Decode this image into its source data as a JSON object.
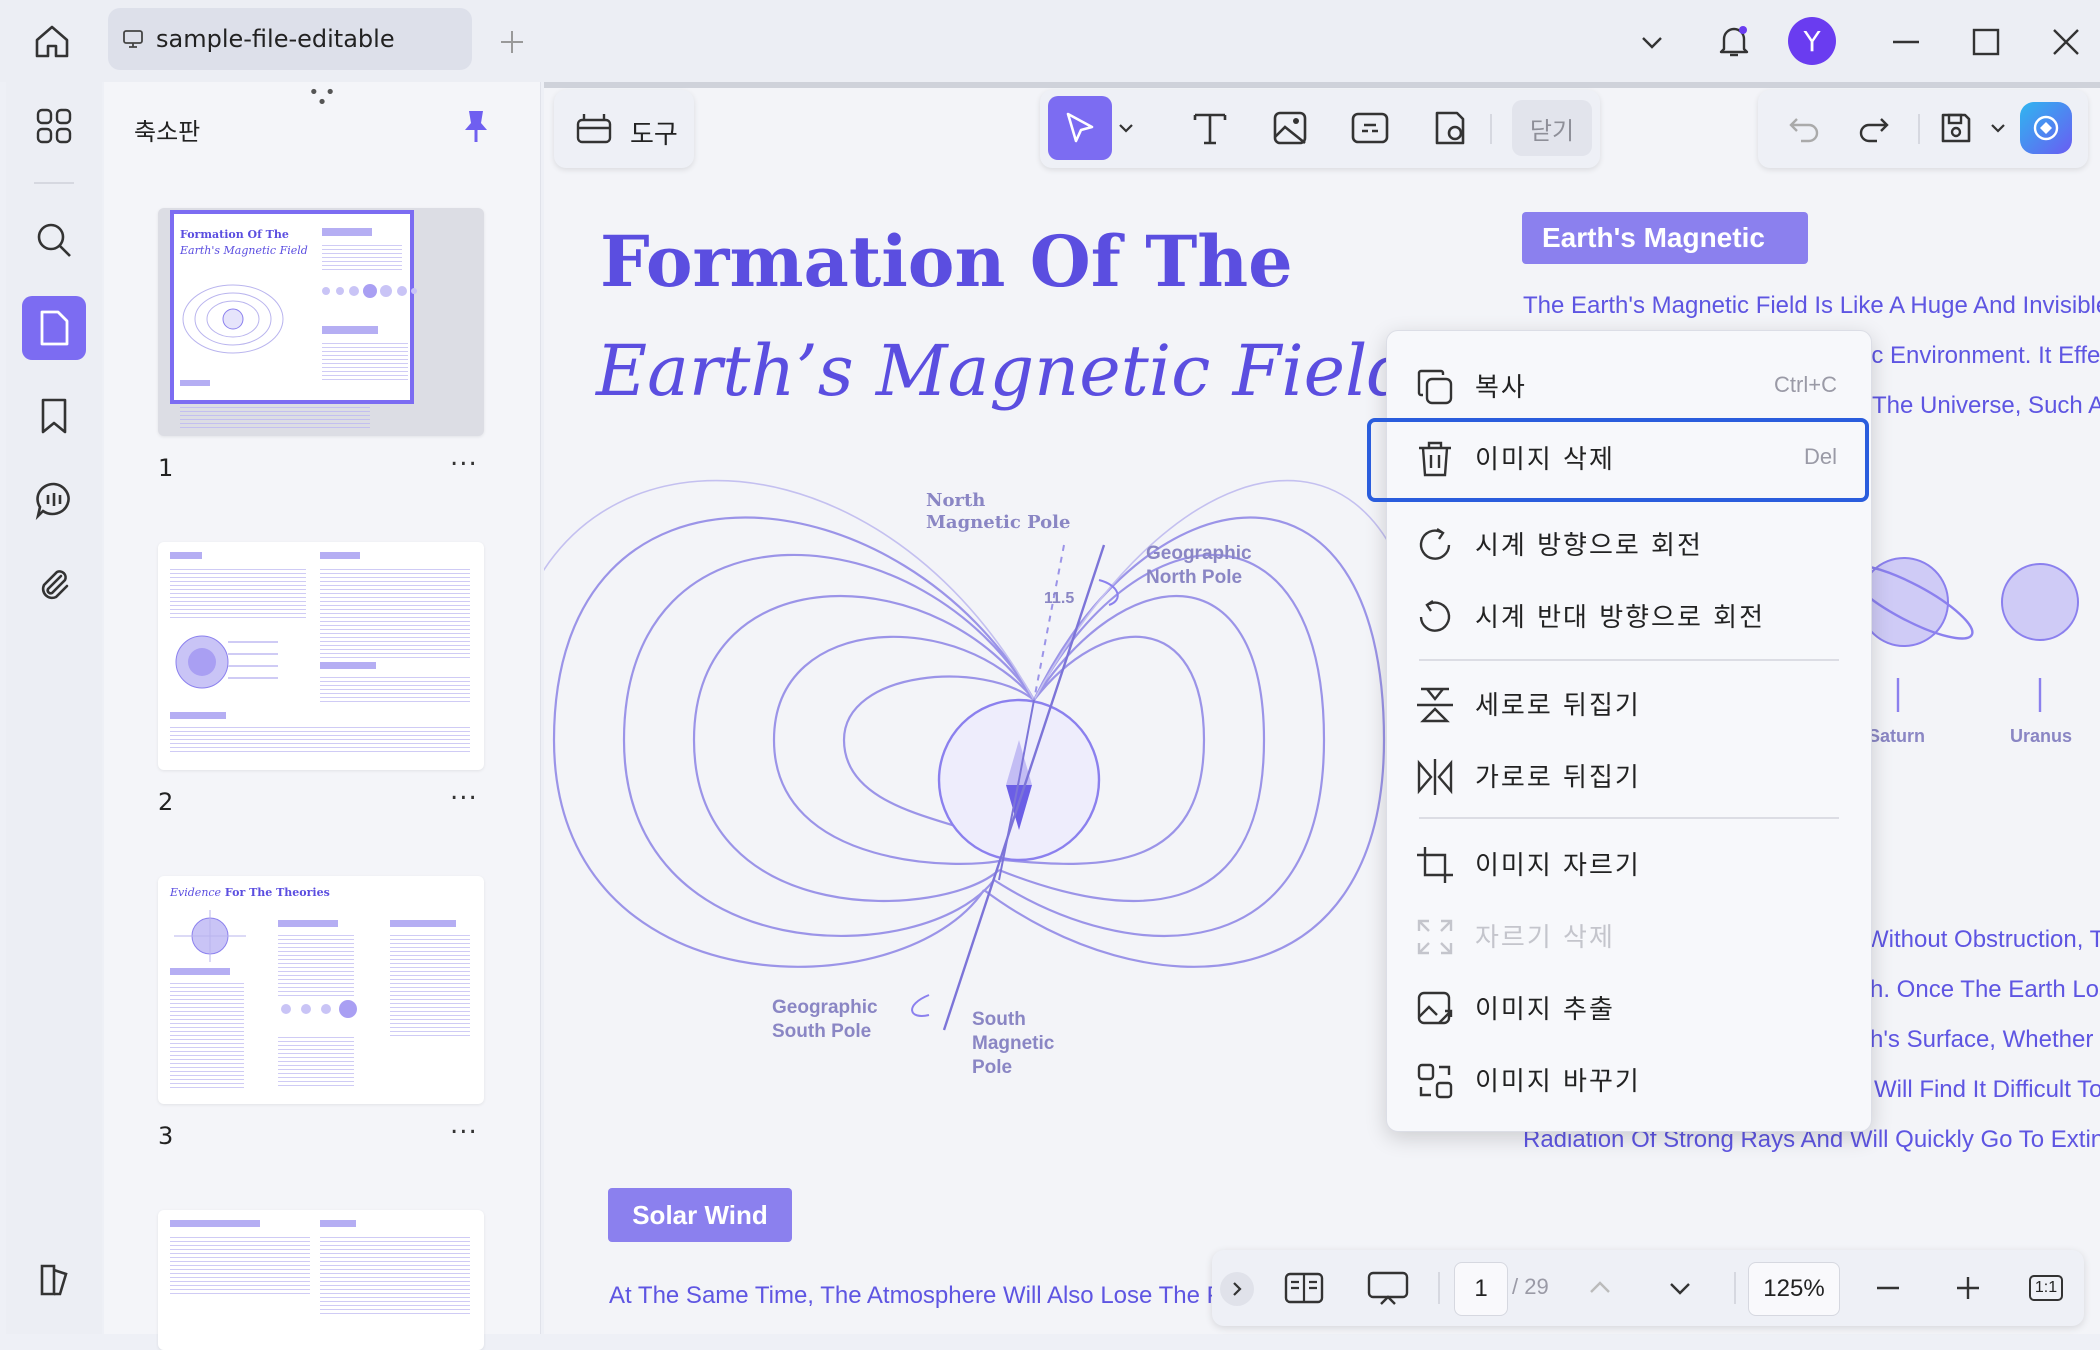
{
  "titlebar": {
    "tab_title": "sample-file-editable",
    "avatar_letter": "Y"
  },
  "panel": {
    "title": "축소판",
    "pages": [
      {
        "number": "1",
        "more": "..."
      },
      {
        "number": "2",
        "more": "..."
      },
      {
        "number": "3",
        "more": "..."
      }
    ]
  },
  "toolbar": {
    "tools_label": "도구",
    "close_label": "닫기"
  },
  "document": {
    "title_line1": "Formation Of The",
    "title_line2": "Earth’s Magnetic Field",
    "section_earth": "Earth's Magnetic",
    "earth_lines": [
      "The Earth's Magnetic Field Is Like A Huge And Invisible",
      "ic Environment. It Effe",
      "The Universe, Such A"
    ],
    "diagram_labels": {
      "north_magnetic_pole": "North\nMagnetic Pole",
      "geographic_north_pole": "Geographic\nNorth Pole",
      "angle": "11.5",
      "geographic_south_pole": "Geographic\nSouth Pole",
      "south_magnetic_pole": "South\nMagnetic\nPole"
    },
    "planets": [
      "Saturn",
      "Uranus"
    ],
    "right_lines": [
      "Without Obstruction, Th",
      "h. Once The Earth Los",
      "h's Surface, Whether",
      "Will Find It Difficult To",
      "Radiation Of Strong Rays And Will Quickly Go To Extin"
    ],
    "section_solar": "Solar Wind",
    "bottom_line": "At The Same Time, The Atmosphere Will Also Lose The P"
  },
  "context_menu": {
    "items": [
      {
        "label": "복사",
        "shortcut": "Ctrl+C"
      },
      {
        "label": "이미지 삭제",
        "shortcut": "Del"
      },
      {
        "label": "시계 방향으로 회전"
      },
      {
        "label": "시계 반대 방향으로 회전"
      },
      {
        "label": "세로로 뒤집기"
      },
      {
        "label": "가로로 뒤집기"
      },
      {
        "label": "이미지 자르기"
      },
      {
        "label": "자르기 삭제"
      },
      {
        "label": "이미지 추출"
      },
      {
        "label": "이미지 바꾸기"
      }
    ]
  },
  "bottombar": {
    "current_page": "1",
    "total_pages": "/ 29",
    "zoom": "125%",
    "fit_label": "1:1"
  },
  "thumbnails": {
    "p1_title_a": "Formation Of The",
    "p1_title_b": "Earth's Magnetic Field",
    "p3_title_a": "Evidence",
    "p3_title_b": " For The Theories"
  },
  "colors": {
    "accent": "#7c6cf2",
    "doc_purple": "#5b4ee0",
    "highlight_border": "#2a5ddd"
  },
  "icons": {
    "home": "home-icon",
    "notification": "bell-icon"
  }
}
